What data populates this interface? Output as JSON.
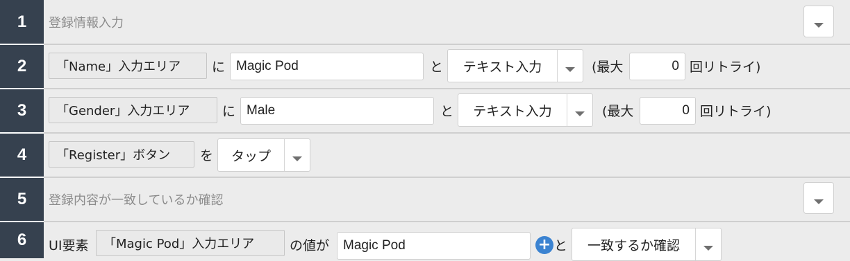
{
  "rows": [
    {
      "number": "1",
      "comment": "登録情報入力"
    },
    {
      "number": "2",
      "element": "「Name」入力エリア",
      "particle": "に",
      "value": "Magic Pod",
      "particle2": "と",
      "action": "テキスト入力",
      "retry_open": "(最大",
      "retry_count": "0",
      "retry_close": "回リトライ)"
    },
    {
      "number": "3",
      "element": "「Gender」入力エリア",
      "particle": "に",
      "value": "Male",
      "particle2": "と",
      "action": "テキスト入力",
      "retry_open": "(最大",
      "retry_count": "0",
      "retry_close": "回リトライ)"
    },
    {
      "number": "4",
      "element": "「Register」ボタン",
      "particle": "を",
      "action": "タップ"
    },
    {
      "number": "5",
      "comment": "登録内容が一致しているか確認"
    },
    {
      "number": "6",
      "prefix": "UI要素",
      "element": "「Magic Pod」入力エリア",
      "particle": "の値が",
      "value": "Magic Pod",
      "particle2": "と",
      "action": "一致するか確認"
    }
  ],
  "icons": {
    "dropdown": "chevron-down-icon",
    "add": "plus-circle-icon",
    "add_color": "#3b83d1"
  },
  "colors": {
    "row_number_bg": "#36414f",
    "content_bg": "#ececec",
    "comment_text": "#8c8c8c"
  }
}
